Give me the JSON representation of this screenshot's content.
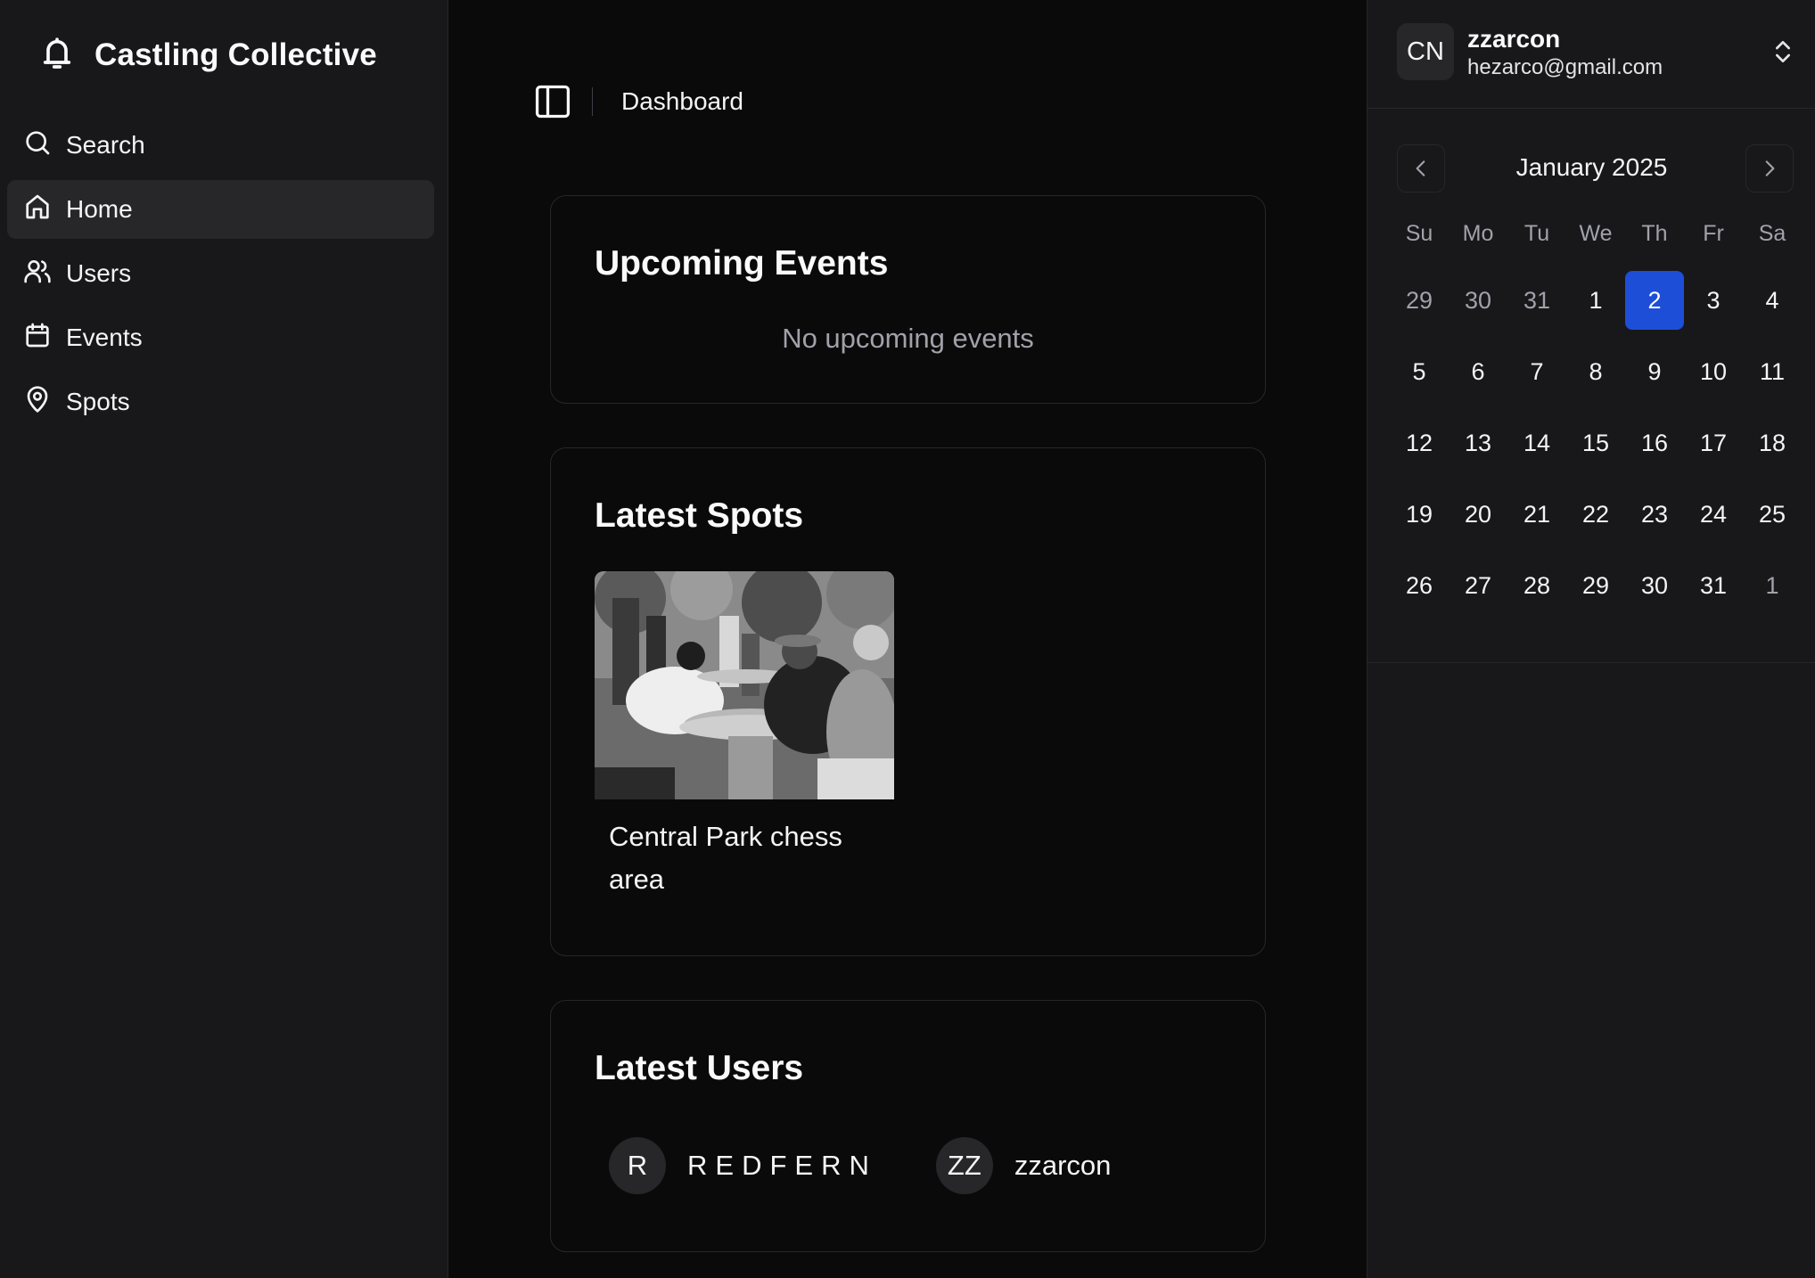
{
  "brand": {
    "name": "Castling Collective",
    "icon": "bell-icon"
  },
  "nav": {
    "items": [
      {
        "label": "Search",
        "icon": "search-icon",
        "active": false
      },
      {
        "label": "Home",
        "icon": "home-icon",
        "active": true
      },
      {
        "label": "Users",
        "icon": "users-icon",
        "active": false
      },
      {
        "label": "Events",
        "icon": "calendar-icon",
        "active": false
      },
      {
        "label": "Spots",
        "icon": "map-pin-icon",
        "active": false
      }
    ]
  },
  "header": {
    "breadcrumb": "Dashboard",
    "toggle_icon": "sidebar-toggle-icon"
  },
  "events": {
    "title": "Upcoming Events",
    "empty_text": "No upcoming events"
  },
  "spots": {
    "title": "Latest Spots",
    "items": [
      {
        "name": "Central Park chess area"
      }
    ]
  },
  "users": {
    "title": "Latest Users",
    "items": [
      {
        "initials": "R",
        "name": "REDFERN"
      },
      {
        "initials": "ZZ",
        "name": "zzarcon"
      }
    ]
  },
  "account": {
    "initials": "CN",
    "username": "zzarcon",
    "email": "hezarco@gmail.com"
  },
  "calendar": {
    "month_label": "January 2025",
    "weekdays": [
      "Su",
      "Mo",
      "Tu",
      "We",
      "Th",
      "Fr",
      "Sa"
    ],
    "days": [
      {
        "n": "29",
        "out": true
      },
      {
        "n": "30",
        "out": true
      },
      {
        "n": "31",
        "out": true
      },
      {
        "n": "1"
      },
      {
        "n": "2",
        "selected": true
      },
      {
        "n": "3"
      },
      {
        "n": "4"
      },
      {
        "n": "5"
      },
      {
        "n": "6"
      },
      {
        "n": "7"
      },
      {
        "n": "8"
      },
      {
        "n": "9"
      },
      {
        "n": "10"
      },
      {
        "n": "11"
      },
      {
        "n": "12"
      },
      {
        "n": "13"
      },
      {
        "n": "14"
      },
      {
        "n": "15"
      },
      {
        "n": "16"
      },
      {
        "n": "17"
      },
      {
        "n": "18"
      },
      {
        "n": "19"
      },
      {
        "n": "20"
      },
      {
        "n": "21"
      },
      {
        "n": "22"
      },
      {
        "n": "23"
      },
      {
        "n": "24"
      },
      {
        "n": "25"
      },
      {
        "n": "26"
      },
      {
        "n": "27"
      },
      {
        "n": "28"
      },
      {
        "n": "29"
      },
      {
        "n": "30"
      },
      {
        "n": "31"
      },
      {
        "n": "1",
        "out": true
      }
    ]
  },
  "colors": {
    "selected_day": "#1d4ed8",
    "background": "#0a0a0a",
    "panel": "#18181b"
  }
}
